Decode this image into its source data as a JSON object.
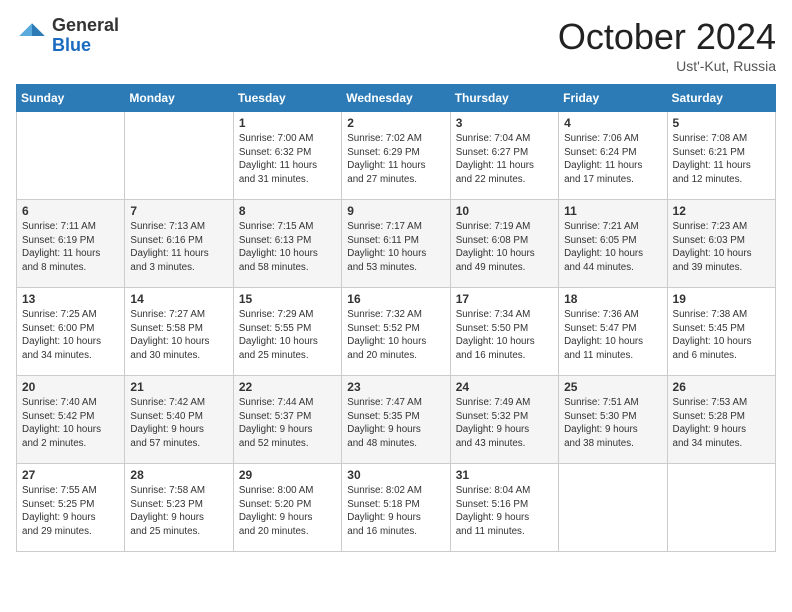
{
  "header": {
    "logo_line1": "General",
    "logo_line2": "Blue",
    "month_year": "October 2024",
    "location": "Ust'-Kut, Russia"
  },
  "weekdays": [
    "Sunday",
    "Monday",
    "Tuesday",
    "Wednesday",
    "Thursday",
    "Friday",
    "Saturday"
  ],
  "weeks": [
    [
      {
        "day": "",
        "info": ""
      },
      {
        "day": "",
        "info": ""
      },
      {
        "day": "1",
        "info": "Sunrise: 7:00 AM\nSunset: 6:32 PM\nDaylight: 11 hours\nand 31 minutes."
      },
      {
        "day": "2",
        "info": "Sunrise: 7:02 AM\nSunset: 6:29 PM\nDaylight: 11 hours\nand 27 minutes."
      },
      {
        "day": "3",
        "info": "Sunrise: 7:04 AM\nSunset: 6:27 PM\nDaylight: 11 hours\nand 22 minutes."
      },
      {
        "day": "4",
        "info": "Sunrise: 7:06 AM\nSunset: 6:24 PM\nDaylight: 11 hours\nand 17 minutes."
      },
      {
        "day": "5",
        "info": "Sunrise: 7:08 AM\nSunset: 6:21 PM\nDaylight: 11 hours\nand 12 minutes."
      }
    ],
    [
      {
        "day": "6",
        "info": "Sunrise: 7:11 AM\nSunset: 6:19 PM\nDaylight: 11 hours\nand 8 minutes."
      },
      {
        "day": "7",
        "info": "Sunrise: 7:13 AM\nSunset: 6:16 PM\nDaylight: 11 hours\nand 3 minutes."
      },
      {
        "day": "8",
        "info": "Sunrise: 7:15 AM\nSunset: 6:13 PM\nDaylight: 10 hours\nand 58 minutes."
      },
      {
        "day": "9",
        "info": "Sunrise: 7:17 AM\nSunset: 6:11 PM\nDaylight: 10 hours\nand 53 minutes."
      },
      {
        "day": "10",
        "info": "Sunrise: 7:19 AM\nSunset: 6:08 PM\nDaylight: 10 hours\nand 49 minutes."
      },
      {
        "day": "11",
        "info": "Sunrise: 7:21 AM\nSunset: 6:05 PM\nDaylight: 10 hours\nand 44 minutes."
      },
      {
        "day": "12",
        "info": "Sunrise: 7:23 AM\nSunset: 6:03 PM\nDaylight: 10 hours\nand 39 minutes."
      }
    ],
    [
      {
        "day": "13",
        "info": "Sunrise: 7:25 AM\nSunset: 6:00 PM\nDaylight: 10 hours\nand 34 minutes."
      },
      {
        "day": "14",
        "info": "Sunrise: 7:27 AM\nSunset: 5:58 PM\nDaylight: 10 hours\nand 30 minutes."
      },
      {
        "day": "15",
        "info": "Sunrise: 7:29 AM\nSunset: 5:55 PM\nDaylight: 10 hours\nand 25 minutes."
      },
      {
        "day": "16",
        "info": "Sunrise: 7:32 AM\nSunset: 5:52 PM\nDaylight: 10 hours\nand 20 minutes."
      },
      {
        "day": "17",
        "info": "Sunrise: 7:34 AM\nSunset: 5:50 PM\nDaylight: 10 hours\nand 16 minutes."
      },
      {
        "day": "18",
        "info": "Sunrise: 7:36 AM\nSunset: 5:47 PM\nDaylight: 10 hours\nand 11 minutes."
      },
      {
        "day": "19",
        "info": "Sunrise: 7:38 AM\nSunset: 5:45 PM\nDaylight: 10 hours\nand 6 minutes."
      }
    ],
    [
      {
        "day": "20",
        "info": "Sunrise: 7:40 AM\nSunset: 5:42 PM\nDaylight: 10 hours\nand 2 minutes."
      },
      {
        "day": "21",
        "info": "Sunrise: 7:42 AM\nSunset: 5:40 PM\nDaylight: 9 hours\nand 57 minutes."
      },
      {
        "day": "22",
        "info": "Sunrise: 7:44 AM\nSunset: 5:37 PM\nDaylight: 9 hours\nand 52 minutes."
      },
      {
        "day": "23",
        "info": "Sunrise: 7:47 AM\nSunset: 5:35 PM\nDaylight: 9 hours\nand 48 minutes."
      },
      {
        "day": "24",
        "info": "Sunrise: 7:49 AM\nSunset: 5:32 PM\nDaylight: 9 hours\nand 43 minutes."
      },
      {
        "day": "25",
        "info": "Sunrise: 7:51 AM\nSunset: 5:30 PM\nDaylight: 9 hours\nand 38 minutes."
      },
      {
        "day": "26",
        "info": "Sunrise: 7:53 AM\nSunset: 5:28 PM\nDaylight: 9 hours\nand 34 minutes."
      }
    ],
    [
      {
        "day": "27",
        "info": "Sunrise: 7:55 AM\nSunset: 5:25 PM\nDaylight: 9 hours\nand 29 minutes."
      },
      {
        "day": "28",
        "info": "Sunrise: 7:58 AM\nSunset: 5:23 PM\nDaylight: 9 hours\nand 25 minutes."
      },
      {
        "day": "29",
        "info": "Sunrise: 8:00 AM\nSunset: 5:20 PM\nDaylight: 9 hours\nand 20 minutes."
      },
      {
        "day": "30",
        "info": "Sunrise: 8:02 AM\nSunset: 5:18 PM\nDaylight: 9 hours\nand 16 minutes."
      },
      {
        "day": "31",
        "info": "Sunrise: 8:04 AM\nSunset: 5:16 PM\nDaylight: 9 hours\nand 11 minutes."
      },
      {
        "day": "",
        "info": ""
      },
      {
        "day": "",
        "info": ""
      }
    ]
  ]
}
